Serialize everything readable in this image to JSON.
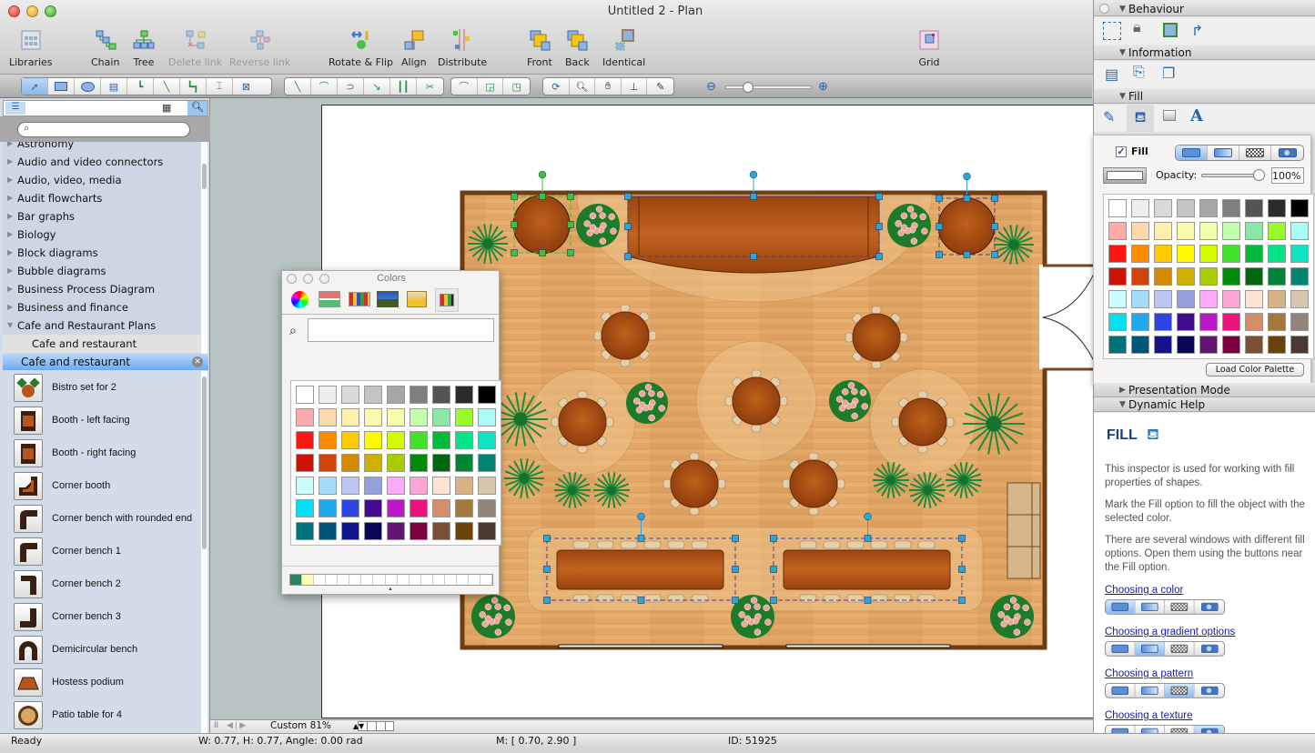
{
  "window": {
    "title": "Untitled 2 - Plan"
  },
  "toolbar": {
    "items": [
      {
        "label": "Libraries",
        "icon": "libraries-icon",
        "enabled": true
      },
      {
        "label": "Chain",
        "icon": "chain-icon",
        "enabled": true
      },
      {
        "label": "Tree",
        "icon": "tree-icon",
        "enabled": true
      },
      {
        "label": "Delete link",
        "icon": "delete-link-icon",
        "enabled": false
      },
      {
        "label": "Reverse link",
        "icon": "reverse-link-icon",
        "enabled": false
      },
      {
        "label": "Rotate & Flip",
        "icon": "rotate-flip-icon",
        "enabled": true
      },
      {
        "label": "Align",
        "icon": "align-icon",
        "enabled": true
      },
      {
        "label": "Distribute",
        "icon": "distribute-icon",
        "enabled": true
      },
      {
        "label": "Front",
        "icon": "bring-front-icon",
        "enabled": true
      },
      {
        "label": "Back",
        "icon": "send-back-icon",
        "enabled": true
      },
      {
        "label": "Identical",
        "icon": "identical-icon",
        "enabled": true
      },
      {
        "label": "Grid",
        "icon": "grid-icon",
        "enabled": true
      }
    ]
  },
  "tools": {
    "draw": [
      "pointer",
      "rectangle",
      "ellipse",
      "text",
      "connector-orthogonal",
      "connector-straight",
      "connector-smart",
      "connector-tree",
      "insert-point"
    ],
    "lines": [
      "line",
      "arc",
      "bezier",
      "polyline",
      "spline",
      "scissors"
    ],
    "bound": [
      "curve-bound",
      "rect-bound",
      "group-bound"
    ],
    "view": [
      "refresh",
      "zoom",
      "pan",
      "stamp",
      "eyedropper"
    ]
  },
  "library": {
    "search_placeholder": "",
    "tree": [
      {
        "label": "Astronomy",
        "expanded": false
      },
      {
        "label": "Audio and video connectors",
        "expanded": false
      },
      {
        "label": "Audio, video, media",
        "expanded": false
      },
      {
        "label": "Audit flowcharts",
        "expanded": false
      },
      {
        "label": "Bar graphs",
        "expanded": false
      },
      {
        "label": "Biology",
        "expanded": false
      },
      {
        "label": "Block diagrams",
        "expanded": false
      },
      {
        "label": "Bubble diagrams",
        "expanded": false
      },
      {
        "label": "Business Process Diagram",
        "expanded": false
      },
      {
        "label": "Business and finance",
        "expanded": false
      },
      {
        "label": "Cafe and Restaurant Plans",
        "expanded": true
      }
    ],
    "tree_child": "Cafe and restaurant",
    "open_library": "Cafe and restaurant",
    "shapes": [
      "Bistro set for 2",
      "Booth - left facing",
      "Booth - right facing",
      "Corner booth",
      "Corner bench with rounded end",
      "Corner bench 1",
      "Corner bench 2",
      "Corner bench 3",
      "Demicircular bench",
      "Hostess podium",
      "Patio table for 4"
    ]
  },
  "canvas": {
    "zoom": "Custom 81%"
  },
  "status": {
    "state": "Ready",
    "dims": "W: 0.77,  H: 0.77,  Angle: 0.00 rad",
    "mouse": "M: [ 0.70, 2.90 ]",
    "id": "ID: 51925"
  },
  "colors_window": {
    "title": "Colors",
    "search_value": "",
    "tabs": [
      "color-wheel",
      "sliders",
      "palettes",
      "image",
      "crayons",
      "swatches"
    ],
    "recent": [
      "#2e8060",
      "#fdfbb0"
    ]
  },
  "palette": [
    "#ffffff",
    "#eeeeee",
    "#dadada",
    "#c4c4c4",
    "#a6a6a6",
    "#7f7f7f",
    "#545454",
    "#2b2b2b",
    "#000000",
    "#fcaaaa",
    "#fdd9ab",
    "#fdf1ab",
    "#fdfbab",
    "#f6fdab",
    "#c4fdab",
    "#8ae8a6",
    "#99fa2a",
    "#abfcf6",
    "#fb1611",
    "#fd8b00",
    "#fdcb00",
    "#fdfa00",
    "#d4fa00",
    "#44e12a",
    "#00ba3c",
    "#00e587",
    "#10e3c4",
    "#cf1207",
    "#d34408",
    "#d48a00",
    "#cdb000",
    "#a9cb00",
    "#008a0a",
    "#006610",
    "#008536",
    "#008572",
    "#ccfcfc",
    "#a4dcfc",
    "#bcc6f2",
    "#949fdb",
    "#fcaafc",
    "#fca5d9",
    "#fde3d4",
    "#d6b284",
    "#d6c6ad",
    "#00e1f2",
    "#1eaaec",
    "#2c44e1",
    "#420a90",
    "#bd16c8",
    "#ed127f",
    "#d38d6a",
    "#a3783c",
    "#928479",
    "#007279",
    "#00557a",
    "#12148b",
    "#0a0657",
    "#621472",
    "#7a003f",
    "#7a4f34",
    "#6b4208",
    "#4b3830"
  ],
  "inspector": {
    "sections": {
      "behaviour": "Behaviour",
      "information": "Information",
      "fill": "Fill",
      "presentation": "Presentation Mode",
      "help": "Dynamic Help"
    },
    "fill": {
      "checkbox_label": "Fill",
      "checked": true,
      "opacity_label": "Opacity:",
      "opacity_value": "100%",
      "opacity": 1.0,
      "load_palette": "Load Color Palette",
      "mode_selected": "color"
    },
    "help": {
      "title": "FILL",
      "p1": "This inspector is used for working with fill properties of shapes.",
      "p2": "Mark the Fill option to fill the object with the selected color.",
      "p3": "There are several windows with different fill options. Open them using the buttons near the Fill option.",
      "links": [
        {
          "label": "Choosing a color",
          "selected": 0
        },
        {
          "label": "Choosing a gradient options",
          "selected": 1
        },
        {
          "label": "Choosing a pattern",
          "selected": 2
        },
        {
          "label": "Choosing a texture",
          "selected": 3
        }
      ]
    }
  }
}
